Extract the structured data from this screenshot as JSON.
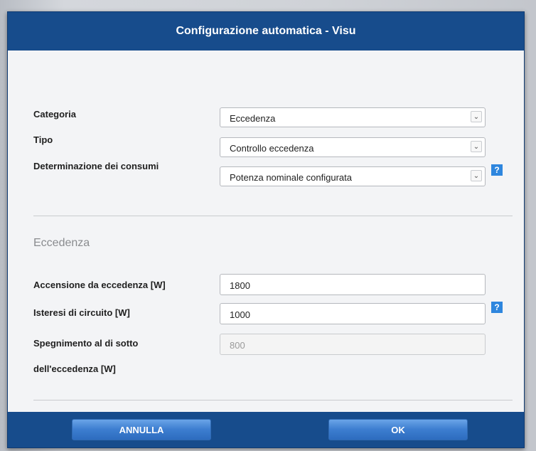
{
  "dialog": {
    "title": "Configurazione automatica - Visu"
  },
  "form": {
    "categoria": {
      "label": "Categoria",
      "value": "Eccedenza"
    },
    "tipo": {
      "label": "Tipo",
      "value": "Controllo eccedenza"
    },
    "determinazione": {
      "label": "Determinazione dei consumi",
      "value": "Potenza nominale configurata"
    }
  },
  "section": {
    "title": "Eccedenza",
    "accensione": {
      "label": "Accensione da eccedenza [W]",
      "value": "1800"
    },
    "isteresi": {
      "label": "Isteresi di circuito [W]",
      "value": "1000"
    },
    "spegnimento": {
      "label_line1": "Spegnimento al di sotto",
      "label_line2": "dell'eccedenza [W]",
      "value": "800"
    }
  },
  "icons": {
    "dropdown": "chevron-down-icon",
    "help": "help-icon",
    "help_glyph": "?"
  },
  "footer": {
    "cancel_label": "ANNULLA",
    "ok_label": "OK"
  },
  "colors": {
    "titlebar": "#174c8c",
    "button": "#3d7ed0",
    "help": "#2e86de"
  }
}
